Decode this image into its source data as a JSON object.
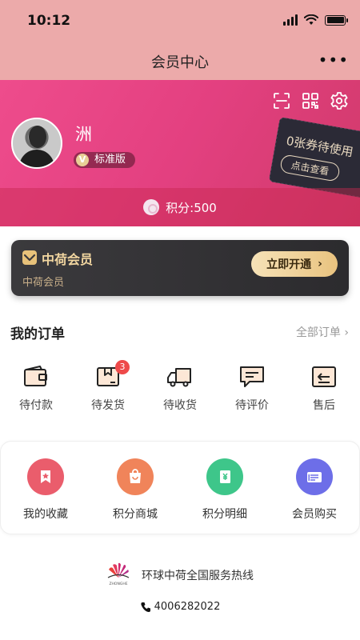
{
  "status_bar": {
    "time": "10:12"
  },
  "nav": {
    "title": "会员中心",
    "more": "•••"
  },
  "profile": {
    "username": "洲",
    "level_badge": "标准版",
    "level_icon": "V",
    "coupon_text": "0张券待使用",
    "coupon_button": "点击查看",
    "points_text": "积分:500"
  },
  "vip": {
    "title": "中荷会员",
    "subtitle": "中荷会员",
    "button": "立即开通",
    "button_arrow": "›"
  },
  "orders": {
    "title": "我的订单",
    "all_link": "全部订单 ›",
    "items": [
      {
        "label": "待付款",
        "icon": "wallet-icon"
      },
      {
        "label": "待发货",
        "icon": "box-icon",
        "badge": "3"
      },
      {
        "label": "待收货",
        "icon": "truck-icon"
      },
      {
        "label": "待评价",
        "icon": "comment-icon"
      },
      {
        "label": "售后",
        "icon": "return-icon"
      }
    ]
  },
  "services": [
    {
      "label": "我的收藏",
      "icon": "bookmark-icon",
      "color": "#ea5d6c"
    },
    {
      "label": "积分商城",
      "icon": "shopping-bag-icon",
      "color": "#f0845a"
    },
    {
      "label": "积分明细",
      "icon": "ledger-icon",
      "color": "#3ec68a"
    },
    {
      "label": "会员购买",
      "icon": "card-icon",
      "color": "#6d6ee8"
    }
  ],
  "footer": {
    "logo_text": "ZHONGHE",
    "hotline_title": "环球中荷全国服务热线",
    "phone": "4006282022"
  },
  "colors": {
    "header_pink": "#e34080",
    "topbar_pink": "#ecaaaa",
    "vip_gold": "#e9c37f",
    "badge_red": "#ee4a4a"
  }
}
